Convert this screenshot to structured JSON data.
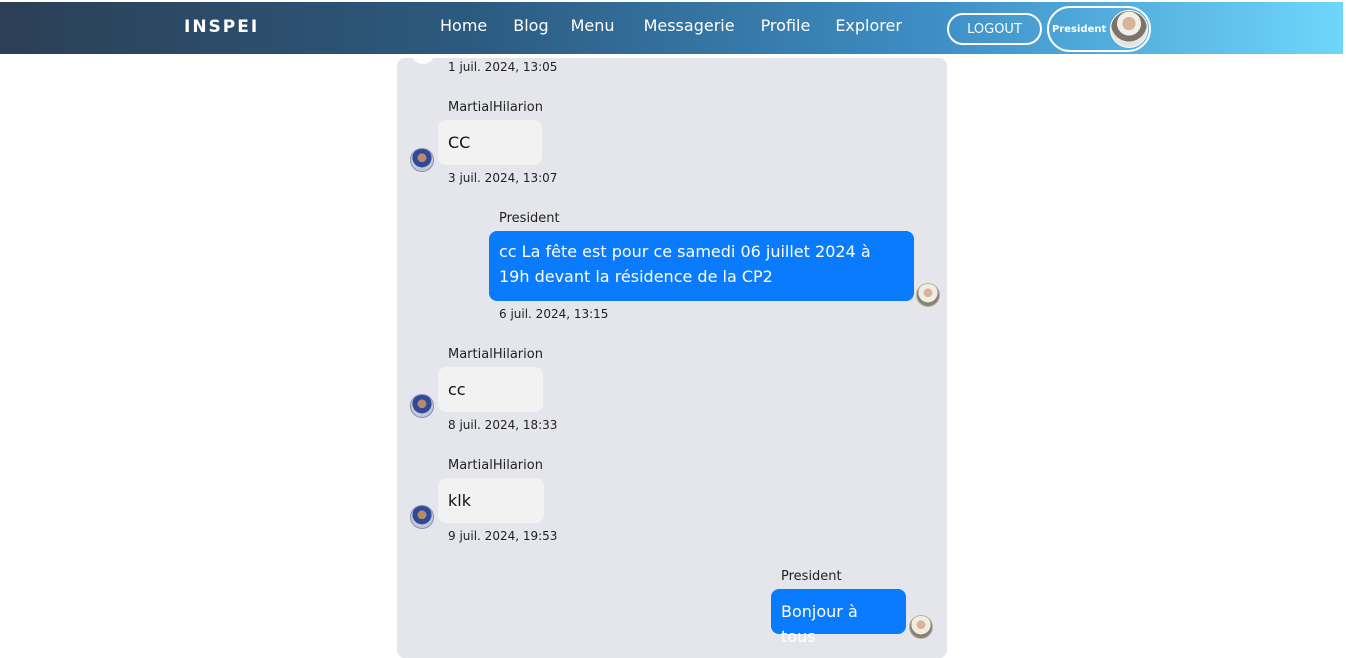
{
  "navbar": {
    "brand": "INSPEI",
    "links": [
      "Home",
      "Blog",
      "Menu",
      "Messagerie",
      "Profile",
      "Explorer"
    ],
    "logout_label": "LOGOUT",
    "user_name": "President"
  },
  "messages": [
    {
      "direction": "in",
      "author": "",
      "text": "",
      "time": "1 juil. 2024, 13:05"
    },
    {
      "direction": "in",
      "author": "MartialHilarion",
      "text": "CC",
      "time": "3 juil. 2024, 13:07"
    },
    {
      "direction": "out",
      "author": "President",
      "text": "cc La fête est pour ce samedi 06 juillet 2024 à 19h devant la résidence de la CP2",
      "time": "6 juil. 2024, 13:15"
    },
    {
      "direction": "in",
      "author": "MartialHilarion",
      "text": "cc",
      "time": "8 juil. 2024, 18:33"
    },
    {
      "direction": "in",
      "author": "MartialHilarion",
      "text": "klk",
      "time": "9 juil. 2024, 19:53"
    },
    {
      "direction": "out",
      "author": "President",
      "text": "Bonjour à tous",
      "time": ""
    }
  ],
  "colors": {
    "outgoing_bubble": "#0a7bfd",
    "incoming_bubble": "#f2f2f3",
    "chat_background": "#e5e6eb"
  }
}
